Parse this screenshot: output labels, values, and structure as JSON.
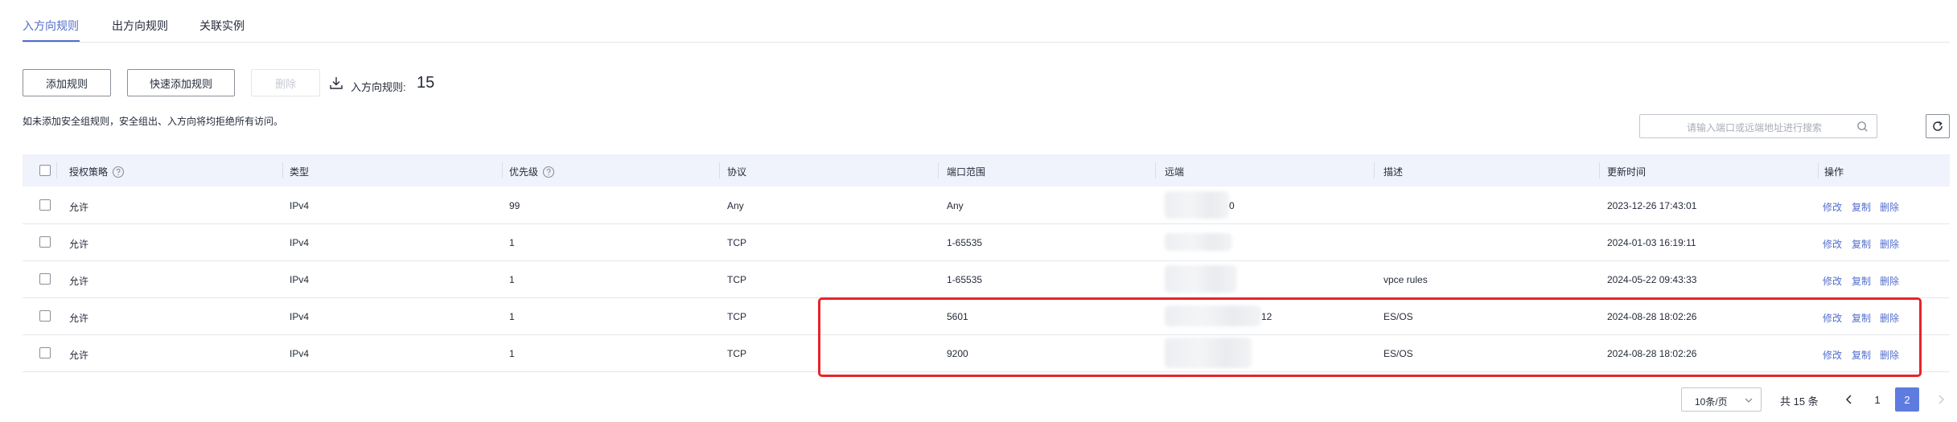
{
  "tabs": [
    {
      "label": "入方向规则",
      "active": true
    },
    {
      "label": "出方向规则",
      "active": false
    },
    {
      "label": "关联实例",
      "active": false
    }
  ],
  "toolbar": {
    "add_rule": "添加规则",
    "quick_add_rule": "快速添加规则",
    "delete": "删除",
    "count_label": "入方向规则:",
    "count_value": "15"
  },
  "hint": "如未添加安全组规则，安全组出、入方向将均拒绝所有访问。",
  "search": {
    "placeholder": "请输入端口或远端地址进行搜索"
  },
  "table": {
    "columns": [
      "授权策略",
      "类型",
      "优先级",
      "协议",
      "端口范围",
      "远端",
      "描述",
      "更新时间",
      "操作"
    ],
    "rows": [
      {
        "policy": "允许",
        "type": "IPv4",
        "priority": "99",
        "protocol": "Any",
        "port": "Any",
        "remote": "0",
        "desc": "",
        "updated": "2023-12-26 17:43:01"
      },
      {
        "policy": "允许",
        "type": "IPv4",
        "priority": "1",
        "protocol": "TCP",
        "port": "1-65535",
        "remote": "",
        "desc": "",
        "updated": "2024-01-03 16:19:11"
      },
      {
        "policy": "允许",
        "type": "IPv4",
        "priority": "1",
        "protocol": "TCP",
        "port": "1-65535",
        "remote": "",
        "desc": "vpce rules",
        "updated": "2024-05-22 09:43:33"
      },
      {
        "policy": "允许",
        "type": "IPv4",
        "priority": "1",
        "protocol": "TCP",
        "port": "5601",
        "remote": "12",
        "desc": "ES/OS",
        "updated": "2024-08-28 18:02:26"
      },
      {
        "policy": "允许",
        "type": "IPv4",
        "priority": "1",
        "protocol": "TCP",
        "port": "9200",
        "remote": "",
        "desc": "ES/OS",
        "updated": "2024-08-28 18:02:26"
      }
    ],
    "actions": {
      "modify": "修改",
      "copy": "复制",
      "delete": "删除"
    }
  },
  "pagination": {
    "page_size": "10条/页",
    "total": "共 15 条",
    "pages": [
      "1",
      "2"
    ],
    "current": "2"
  },
  "colors": {
    "accent": "#526ecc",
    "highlight_border": "#e6242a",
    "header_bg": "#f0f3fc"
  }
}
